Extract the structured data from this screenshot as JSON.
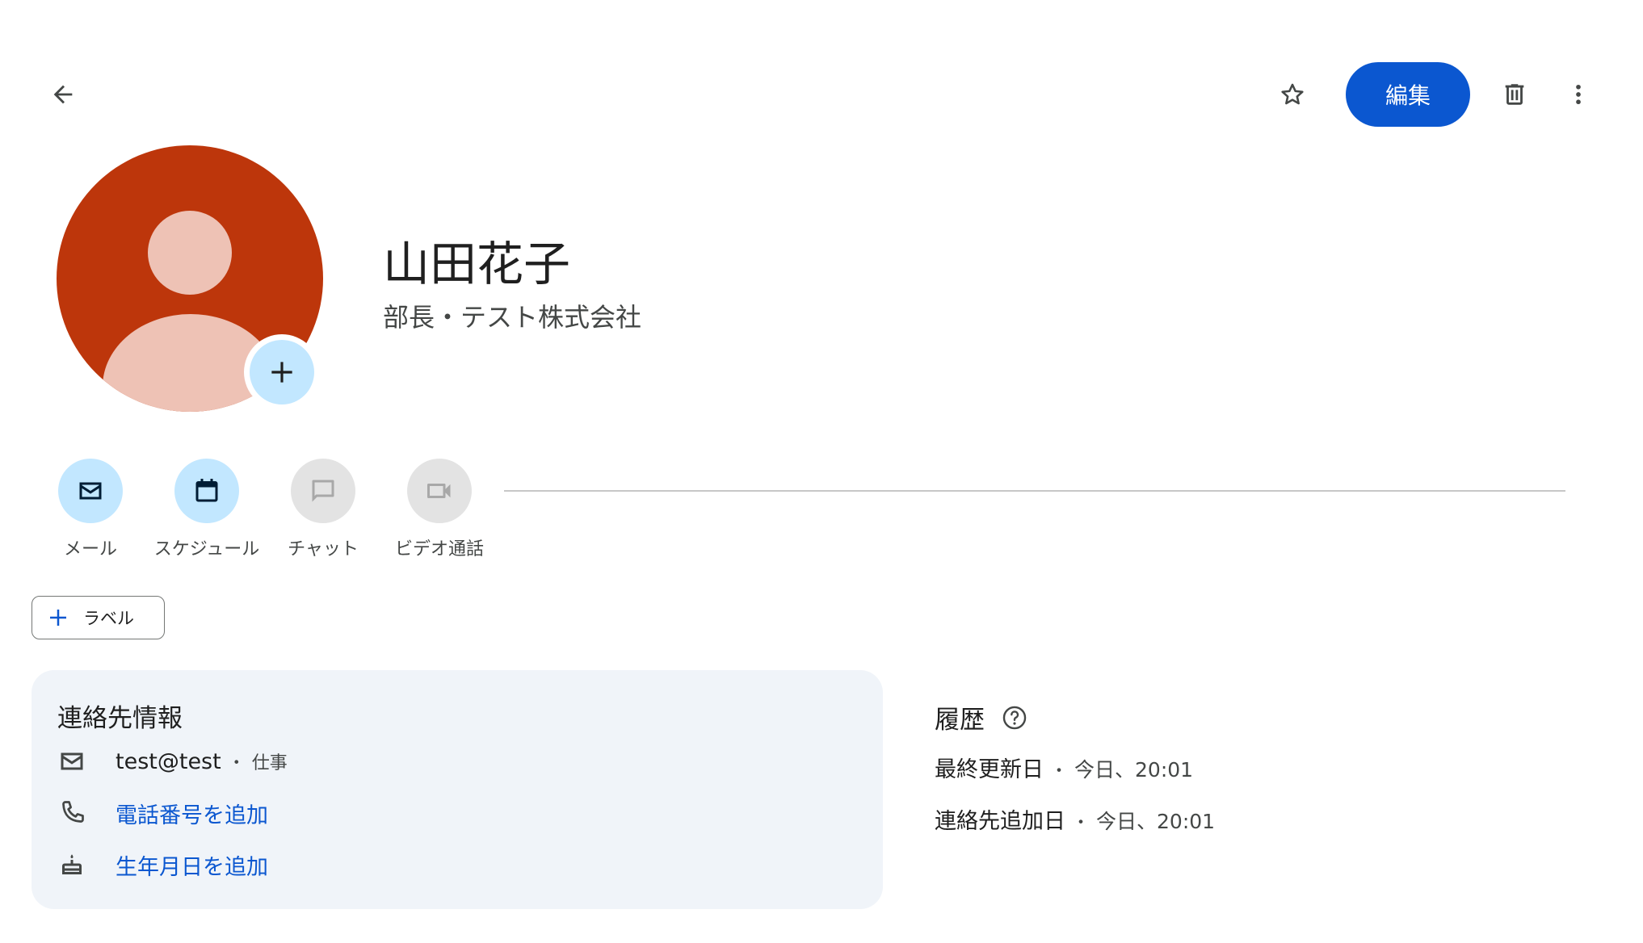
{
  "toolbar": {
    "back_icon": "arrow-back-icon",
    "star_icon": "star-outline-icon",
    "edit_label": "編集",
    "delete_icon": "trash-icon",
    "more_icon": "more-vert-icon"
  },
  "profile": {
    "name": "山田花子",
    "subtitle": "部長・テスト株式会社",
    "avatar_color": "#bd360b",
    "avatar_figure_color": "#eec2b5",
    "add_photo_icon": "plus-icon"
  },
  "actions": [
    {
      "label": "メール",
      "icon": "mail-icon",
      "enabled": true
    },
    {
      "label": "スケジュール",
      "icon": "calendar-icon",
      "enabled": true
    },
    {
      "label": "チャット",
      "icon": "chat-icon",
      "enabled": false
    },
    {
      "label": "ビデオ通話",
      "icon": "videocam-icon",
      "enabled": false
    }
  ],
  "label_chip": {
    "label": "ラベル",
    "icon": "plus-icon"
  },
  "contact_info": {
    "title": "連絡先情報",
    "email": {
      "value": "test@test",
      "separator": "・",
      "type": "仕事",
      "icon": "mail-icon"
    },
    "phone": {
      "value": "電話番号を追加",
      "icon": "phone-icon"
    },
    "birthday": {
      "value": "生年月日を追加",
      "icon": "cake-icon"
    }
  },
  "history": {
    "title": "履歴",
    "help_icon": "help-circle-icon",
    "last_updated": {
      "label": "最終更新日",
      "separator": "・",
      "value": "今日、20:01"
    },
    "added": {
      "label": "連絡先追加日",
      "separator": "・",
      "value": "今日、20:01"
    }
  },
  "colors": {
    "primary": "#0b57d0",
    "action_active_bg": "#c2e7ff",
    "action_disabled_bg": "#e3e3e3",
    "card_bg": "#f0f4f9"
  }
}
